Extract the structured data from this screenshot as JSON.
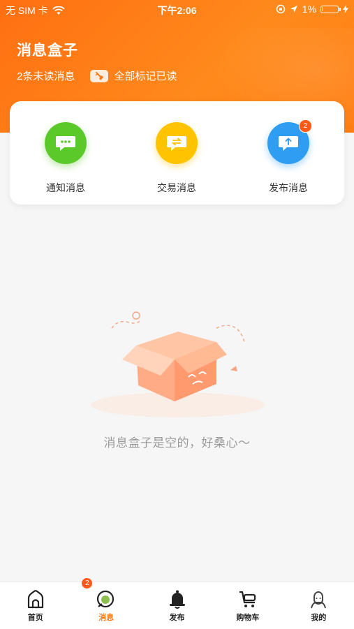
{
  "status_bar": {
    "carrier": "无 SIM 卡",
    "time": "下午2:06",
    "battery_percent": "1%",
    "battery_level": 0.01
  },
  "header": {
    "title": "消息盒子",
    "unread_text": "2条未读消息",
    "mark_all_read": "全部标记已读"
  },
  "categories": [
    {
      "label": "通知消息",
      "color": "#5cc92a",
      "icon": "chat-dots-icon",
      "badge": ""
    },
    {
      "label": "交易消息",
      "color": "#ffc300",
      "icon": "exchange-icon",
      "badge": ""
    },
    {
      "label": "发布消息",
      "color": "#2f9df2",
      "icon": "upload-arrow-icon",
      "badge": "2"
    }
  ],
  "empty_state": {
    "text": "消息盒子是空的，好桑心～",
    "icon": "empty-box-icon"
  },
  "tab_bar": {
    "items": [
      {
        "label": "首页",
        "icon": "home-icon"
      },
      {
        "label": "消息",
        "icon": "message-icon",
        "badge": "2",
        "active": true
      },
      {
        "label": "发布",
        "icon": "bell-icon"
      },
      {
        "label": "购物车",
        "icon": "cart-icon"
      },
      {
        "label": "我的",
        "icon": "profile-icon"
      }
    ],
    "accent": "#ff7a12"
  },
  "colors": {
    "header_orange": "#ff7a12",
    "badge_red": "#ff5a1a"
  }
}
